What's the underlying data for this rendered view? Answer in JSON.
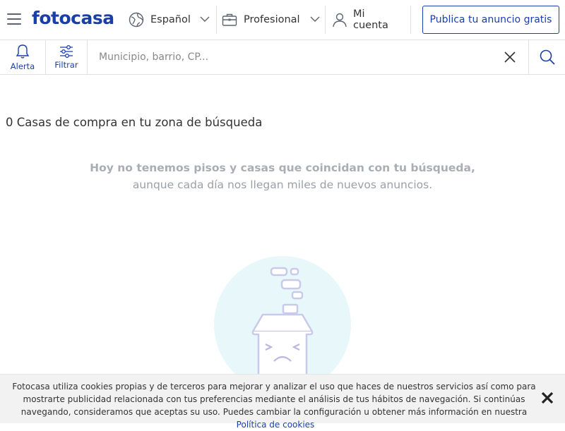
{
  "header": {
    "logo": "fotocasa",
    "language_label": "Español",
    "professional_label": "Profesional",
    "account_label": "Mi cuenta",
    "publish_button": "Publica tu anuncio gratis"
  },
  "searchbar": {
    "alert_label": "Alerta",
    "filter_label": "Filtrar",
    "search_placeholder": "Municipio, barrio, CP...",
    "search_value": ""
  },
  "results": {
    "title": "0 Casas de compra en tu zona de búsqueda",
    "empty_line1": "Hoy no tenemos pisos y casas que coincidan con tu búsqueda,",
    "empty_line2": "aunque cada día nos llegan miles de nuevos anuncios."
  },
  "cookies": {
    "text": "Fotocasa utiliza cookies propias y de terceros para mejorar y analizar el uso que haces de nuestros servicios así como para mostrarte publicidad relacionada con tus preferencias mediante el análisis de tus hábitos de navegación. Si continúas navegando, consideramos que aceptas su uso. Puedes cambiar la configuración u obtener más información en nuestra",
    "link_label": "Política de cookies"
  },
  "colors": {
    "brand": "#1b3fa9",
    "muted_text": "#9aa0a6",
    "illustration_bg": "#e8f7fa",
    "illustration_line": "#c9c9ea"
  },
  "icons": {
    "menu": "hamburger-icon",
    "language": "globe-icon",
    "professional": "briefcase-icon",
    "account": "user-icon",
    "alert": "bell-icon",
    "filter": "sliders-icon",
    "clear": "close-icon",
    "search": "search-icon",
    "cookie_close": "close-icon"
  }
}
